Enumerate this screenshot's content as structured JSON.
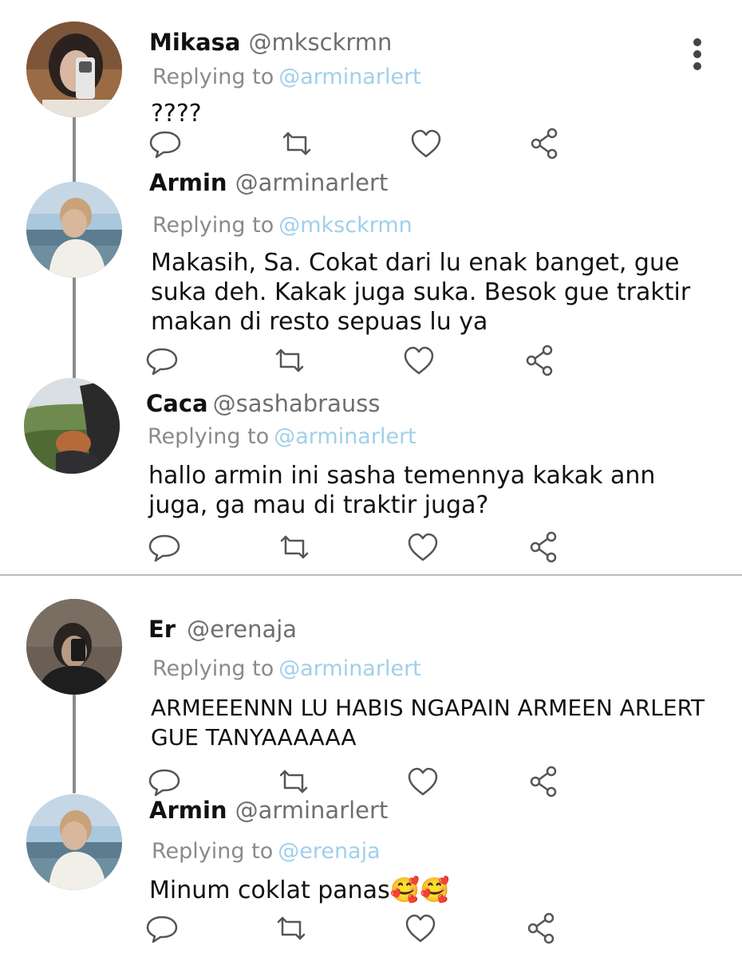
{
  "threads": [
    {
      "tweets": [
        {
          "name": "Mikasa",
          "handle": "@mksckrmn",
          "replying_label": "Replying to",
          "replying_to": "@arminarlert",
          "text": "????",
          "avatar": "mikasa-avatar"
        },
        {
          "name": "Armin",
          "handle": "@arminarlert",
          "replying_label": "Replying to",
          "replying_to": "@mksckrmn",
          "text": "Makasih, Sa. Cokat dari lu enak banget, gue\nsuka deh. Kakak juga suka. Besok gue traktir\nmakan di resto sepuas lu ya",
          "avatar": "armin-avatar"
        },
        {
          "name": "Caca",
          "handle": "@sashabrauss",
          "replying_label": "Replying to",
          "replying_to": "@arminarlert",
          "text": "hallo armin ini sasha temennya kakak ann\njuga, ga mau di traktir juga?",
          "avatar": "caca-avatar"
        }
      ]
    },
    {
      "tweets": [
        {
          "name": "Er",
          "handle": "@erenaja",
          "replying_label": "Replying to",
          "replying_to": "@arminarlert",
          "text": "ARMEEENNN LU HABIS NGAPAIN ARMEEN ARLERT\nGUE TANYAAAAAA",
          "avatar": "er-avatar"
        },
        {
          "name": "Armin",
          "handle": "@arminarlert",
          "replying_label": "Replying to",
          "replying_to": "@erenaja",
          "text": "Minum coklat panas🥰🥰",
          "avatar": "armin-avatar"
        }
      ]
    }
  ],
  "icons": {
    "reply": "reply-icon",
    "retweet": "retweet-icon",
    "like": "heart-icon",
    "share": "share-icon",
    "more": "more-vertical-icon"
  },
  "colors": {
    "mention": "#9fd0ea",
    "muted": "#8a8a8a",
    "thread_line": "#8c8c8c",
    "divider": "#bdbdbd"
  }
}
